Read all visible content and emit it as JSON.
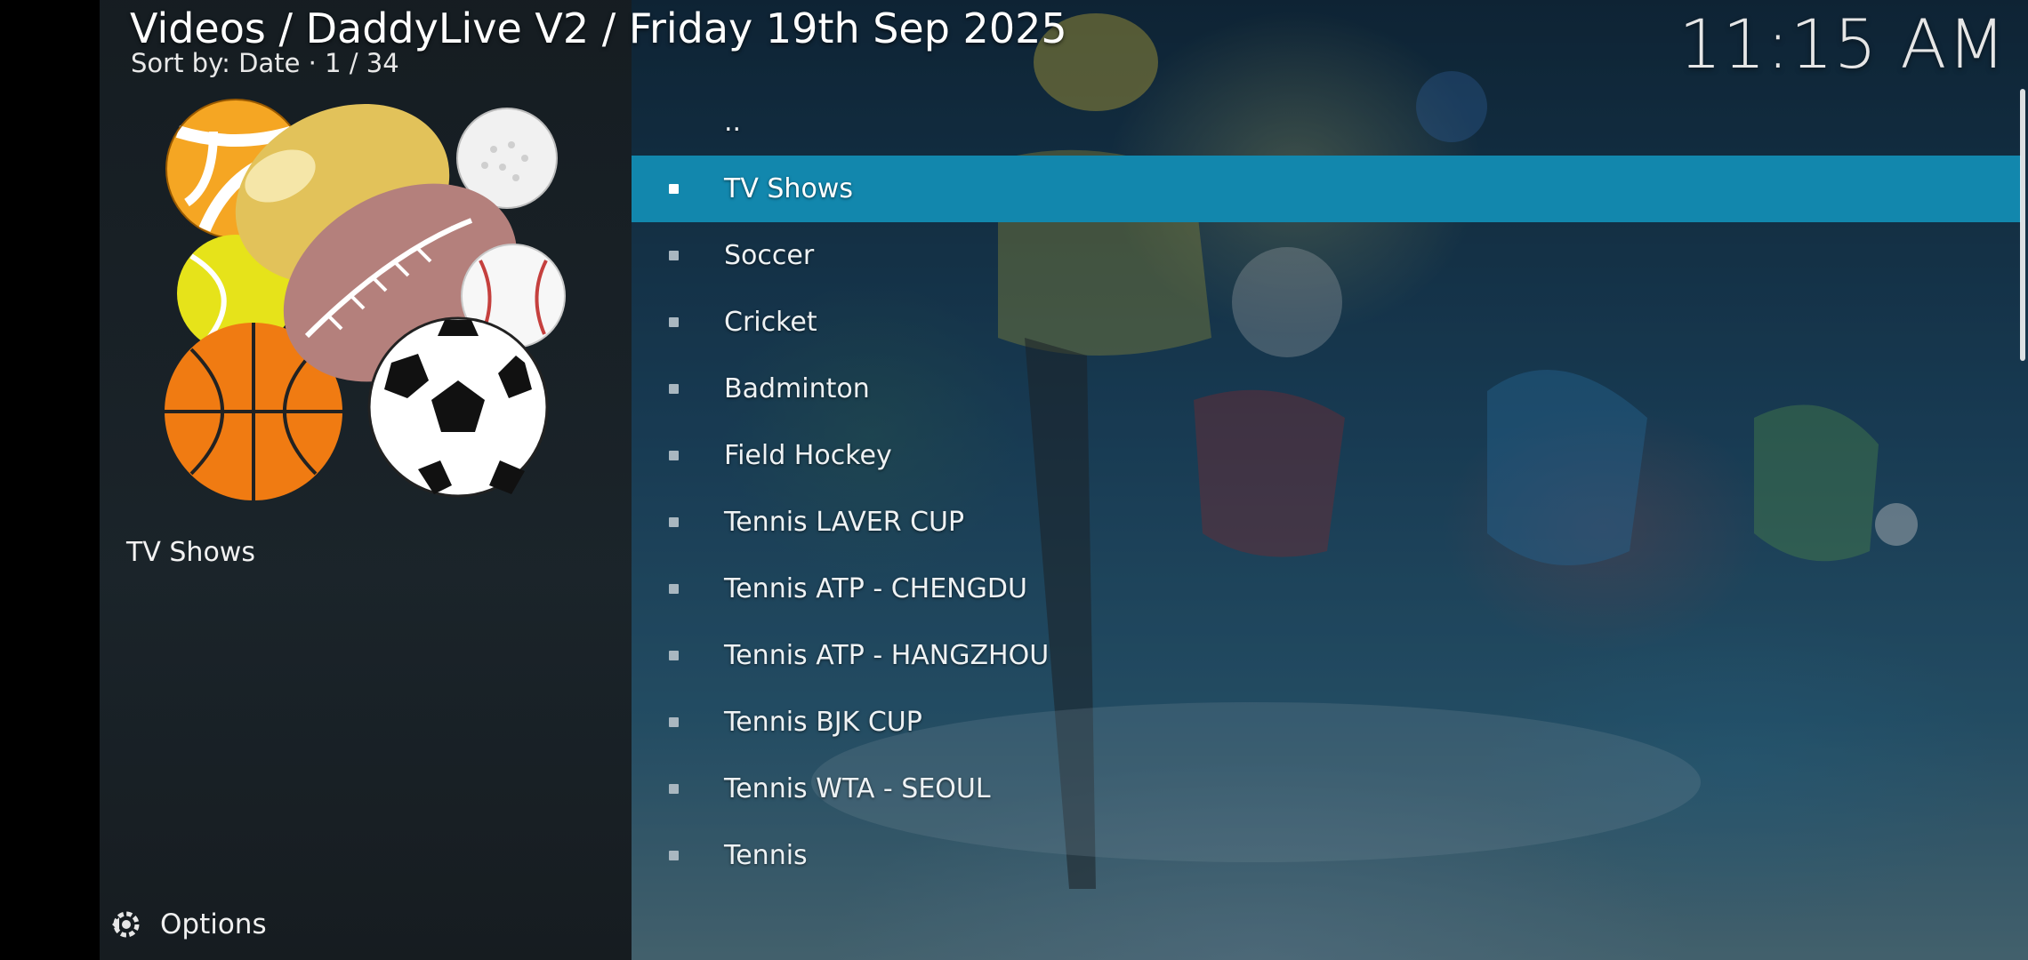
{
  "header": {
    "breadcrumb": "Videos / DaddyLive V2 / Friday 19th Sep 2025",
    "sort_info": "Sort by: Date  ·  1 / 34",
    "clock": "11:15 AM"
  },
  "info_panel": {
    "thumbnail_icon": "sports-balls-icon",
    "selected_label": "TV Shows"
  },
  "options": {
    "icon": "options-gear-icon",
    "label": "Options"
  },
  "list": {
    "items": [
      {
        "label": ".."
      },
      {
        "label": "TV Shows",
        "focused": true
      },
      {
        "label": "Soccer"
      },
      {
        "label": "Cricket"
      },
      {
        "label": "Badminton"
      },
      {
        "label": "Field Hockey"
      },
      {
        "label": "Tennis LAVER CUP"
      },
      {
        "label": "Tennis ATP - CHENGDU"
      },
      {
        "label": "Tennis ATP - HANGZHOU"
      },
      {
        "label": "Tennis BJK CUP"
      },
      {
        "label": "Tennis WTA - SEOUL"
      },
      {
        "label": "Tennis"
      }
    ]
  },
  "colors": {
    "focus_highlight": "#1287ad",
    "left_panel": "#1a2024"
  }
}
